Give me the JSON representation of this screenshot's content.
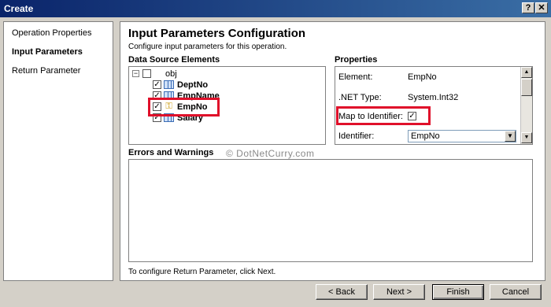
{
  "window": {
    "title": "Create",
    "help_label": "?",
    "close_label": "✕"
  },
  "nav": {
    "items": [
      {
        "label": "Operation Properties",
        "active": false
      },
      {
        "label": "Input Parameters",
        "active": true
      },
      {
        "label": "Return Parameter",
        "active": false
      }
    ]
  },
  "main": {
    "title": "Input Parameters Configuration",
    "subtitle": "Configure input parameters for this operation.",
    "data_source_label": "Data Source Elements",
    "properties_label": "Properties",
    "errors_label": "Errors and Warnings",
    "footnote": "To configure Return Parameter, click Next.",
    "watermark": "© DotNetCurry.com"
  },
  "tree": {
    "root": {
      "label": "obj",
      "checked": false,
      "expand_glyph": "−"
    },
    "children": [
      {
        "label": "DeptNo",
        "checked": true,
        "icon": "column-icon"
      },
      {
        "label": "EmpName",
        "checked": true,
        "icon": "column-icon"
      },
      {
        "label": "EmpNo",
        "checked": true,
        "icon": "key-icon",
        "selected": true
      },
      {
        "label": "Salary",
        "checked": true,
        "icon": "column-icon"
      }
    ],
    "check_glyph": "✓"
  },
  "properties": {
    "element_label": "Element:",
    "element_value": "EmpNo",
    "net_type_label": ".NET Type:",
    "net_type_value": "System.Int32",
    "map_label": "Map to Identifier:",
    "map_checked": true,
    "identifier_label": "Identifier:",
    "identifier_value": "EmpNo"
  },
  "buttons": {
    "back": "< Back",
    "next": "Next >",
    "finish": "Finish",
    "cancel": "Cancel"
  },
  "colors": {
    "highlight": "#e0102a",
    "title_bar": "#0a246a"
  }
}
